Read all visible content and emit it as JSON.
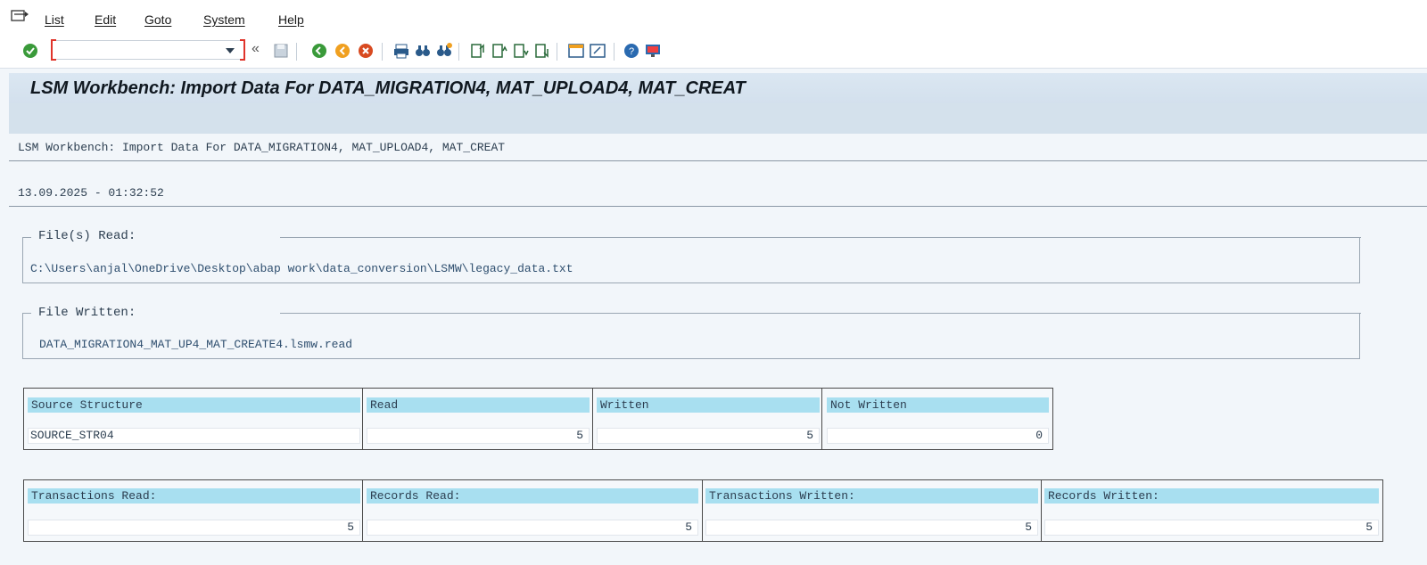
{
  "menu": {
    "items": [
      "List",
      "Edit",
      "Goto",
      "System",
      "Help"
    ]
  },
  "toolbar": {
    "command_field": "",
    "icons": [
      "enter-icon",
      "save-icon",
      "back-icon",
      "exit-icon",
      "cancel-icon",
      "print-icon",
      "find-icon",
      "find-next-icon",
      "first-page-icon",
      "previous-page-icon",
      "next-page-icon",
      "last-page-icon",
      "create-session-icon",
      "shortcut-icon",
      "help-icon",
      "customize-layout-icon"
    ]
  },
  "title": "LSM Workbench: Import Data For DATA_MIGRATION4, MAT_UPLOAD4, MAT_CREAT",
  "report": {
    "header": "LSM Workbench: Import Data For DATA_MIGRATION4, MAT_UPLOAD4, MAT_CREAT",
    "timestamp": "13.09.2025 - 01:32:52",
    "files_read": {
      "label": "File(s) Read:",
      "value": "C:\\Users\\anjal\\OneDrive\\Desktop\\abap work\\data_conversion\\LSMW\\legacy_data.txt"
    },
    "file_written": {
      "label": "File Written:",
      "value": "DATA_MIGRATION4_MAT_UP4_MAT_CREATE4.lsmw.read"
    },
    "structure_table": {
      "headers": [
        "Source Structure",
        "Read",
        "Written",
        "Not Written"
      ],
      "row": [
        "SOURCE_STR04",
        "5",
        "5",
        "0"
      ]
    },
    "totals_table": {
      "headers": [
        "Transactions Read:",
        "Records Read:",
        "Transactions Written:",
        "Records Written:"
      ],
      "row": [
        "5",
        "5",
        "5",
        "5"
      ]
    }
  },
  "colors": {
    "header_cell": "#a8dff0",
    "title_bar": "#d3e0ed",
    "background": "#f2f6fa"
  }
}
